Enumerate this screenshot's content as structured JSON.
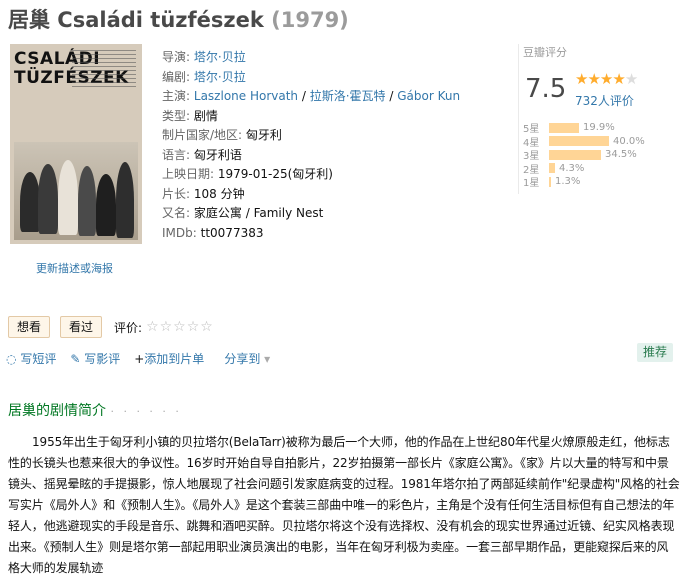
{
  "header": {
    "title": "居巢 Családi tüzfészek",
    "year": "(1979)"
  },
  "poster": {
    "poster_title": "CSALÁDI TÜZFÉSZEK",
    "caption": "更新描述或海报"
  },
  "info": {
    "director_label": "导演",
    "director": "塔尔·贝拉",
    "writer_label": "编剧",
    "writer": "塔尔·贝拉",
    "cast_label": "主演",
    "cast": [
      "Laszlone Horvath",
      "拉斯洛·霍瓦特",
      "Gábor Kun"
    ],
    "genre_label": "类型",
    "genre": "剧情",
    "country_label": "制片国家/地区",
    "country": "匈牙利",
    "language_label": "语言",
    "language": "匈牙利语",
    "release_label": "上映日期",
    "release": "1979-01-25(匈牙利)",
    "runtime_label": "片长",
    "runtime": "108 分钟",
    "aka_label": "又名",
    "aka": "家庭公寓 / Family Nest",
    "imdb_label": "IMDb",
    "imdb": "tt0077383"
  },
  "rating": {
    "header": "豆瓣评分",
    "score": "7.5",
    "stars_filled": 4,
    "stars_total": 5,
    "votes": "732人评价",
    "bar_color": "#ffd596",
    "breakdown": [
      {
        "label": "5星",
        "pct": "19.9%",
        "value": 19.9
      },
      {
        "label": "4星",
        "pct": "40.0%",
        "value": 40.0
      },
      {
        "label": "3星",
        "pct": "34.5%",
        "value": 34.5
      },
      {
        "label": "2星",
        "pct": "4.3%",
        "value": 4.3
      },
      {
        "label": "1星",
        "pct": "1.3%",
        "value": 1.3
      }
    ]
  },
  "actions": {
    "want": "想看",
    "watched": "看过",
    "rate_label": "评价:",
    "empty_stars": "☆☆☆☆☆"
  },
  "links": {
    "comment": "写短评",
    "review": "写影评",
    "add_list": "添加到片单",
    "share": "分享到",
    "recommend": "推荐"
  },
  "synopsis": {
    "title": "居巢的剧情简介",
    "dots": "· · · · · ·",
    "text": "1955年出生于匈牙利小镇的贝拉塔尔(BelaTarr)被称为最后一个大师，他的作品在上世纪80年代星火燎原般走红，他标志性的长镜头也惹来很大的争议性。16岁时开始自导自拍影片，22岁拍摄第一部长片《家庭公寓》。《家》片以大量的特写和中景镜头、摇晃晕眩的手提摄影，惊人地展现了社会问题引发家庭病变的过程。1981年塔尔拍了两部延续前作\"纪录虚构\"风格的社会写实片《局外人》和《预制人生》。《局外人》是这个套装三部曲中唯一的彩色片，主角是个没有任何生活目标但有自己想法的年轻人，他逃避现实的手段是音乐、跳舞和酒吧买醉。贝拉塔尔将这个没有选择权、没有机会的现实世界通过近镜、纪实风格表现出来。《预制人生》则是塔尔第一部起用职业演员演出的电影，当年在匈牙利极为卖座。一套三部早期作品，更能窥探后来的风格大师的发展轨迹"
  }
}
